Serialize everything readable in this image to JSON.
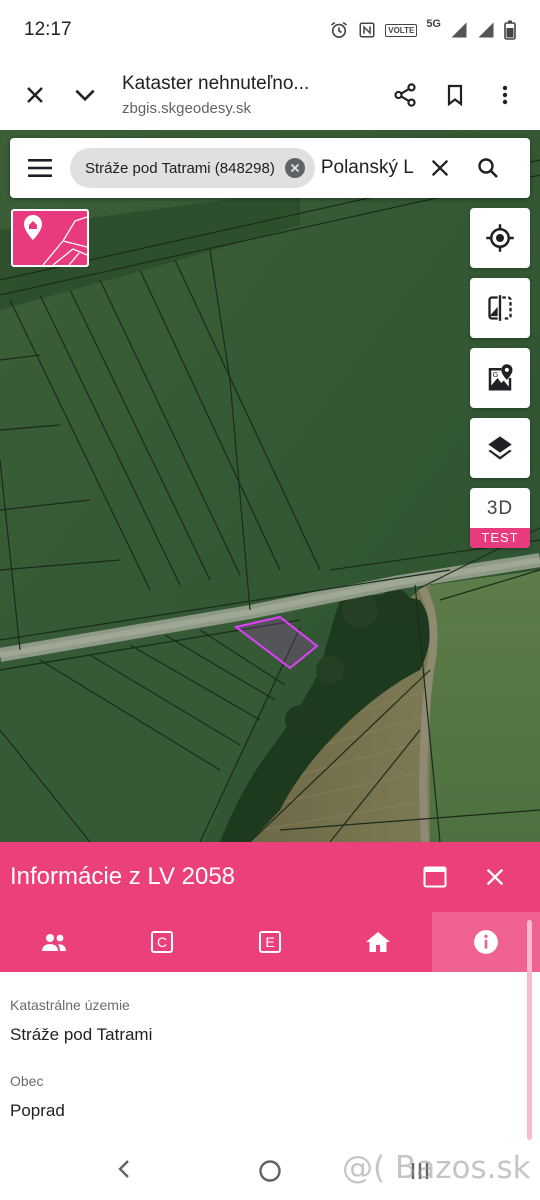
{
  "status_bar": {
    "time": "12:17",
    "network": "5G",
    "volte": "VOLTE"
  },
  "browser": {
    "title": "Kataster nehnuteľno...",
    "url": "zbgis.skgeodesy.sk"
  },
  "search": {
    "chip_label": "Stráže pod Tatrami (848298)",
    "query": "Polanský L"
  },
  "map_controls": {
    "btn_3d_label": "3D",
    "btn_3d_badge": "TEST"
  },
  "panel": {
    "title": "Informácie z LV 2058",
    "tabs": [
      {
        "icon": "people-icon"
      },
      {
        "icon": "letter-c-icon"
      },
      {
        "icon": "letter-e-icon"
      },
      {
        "icon": "home-icon"
      },
      {
        "icon": "info-icon",
        "active": true
      }
    ],
    "fields": [
      {
        "label": "Katastrálne územie",
        "value": "Stráže pod Tatrami"
      },
      {
        "label": "Obec",
        "value": "Poprad"
      }
    ]
  },
  "watermark": "@( Bazos.sk",
  "colors": {
    "accent": "#ec407a",
    "accent_light": "#f06292",
    "parcel_outline": "#e040fb"
  }
}
